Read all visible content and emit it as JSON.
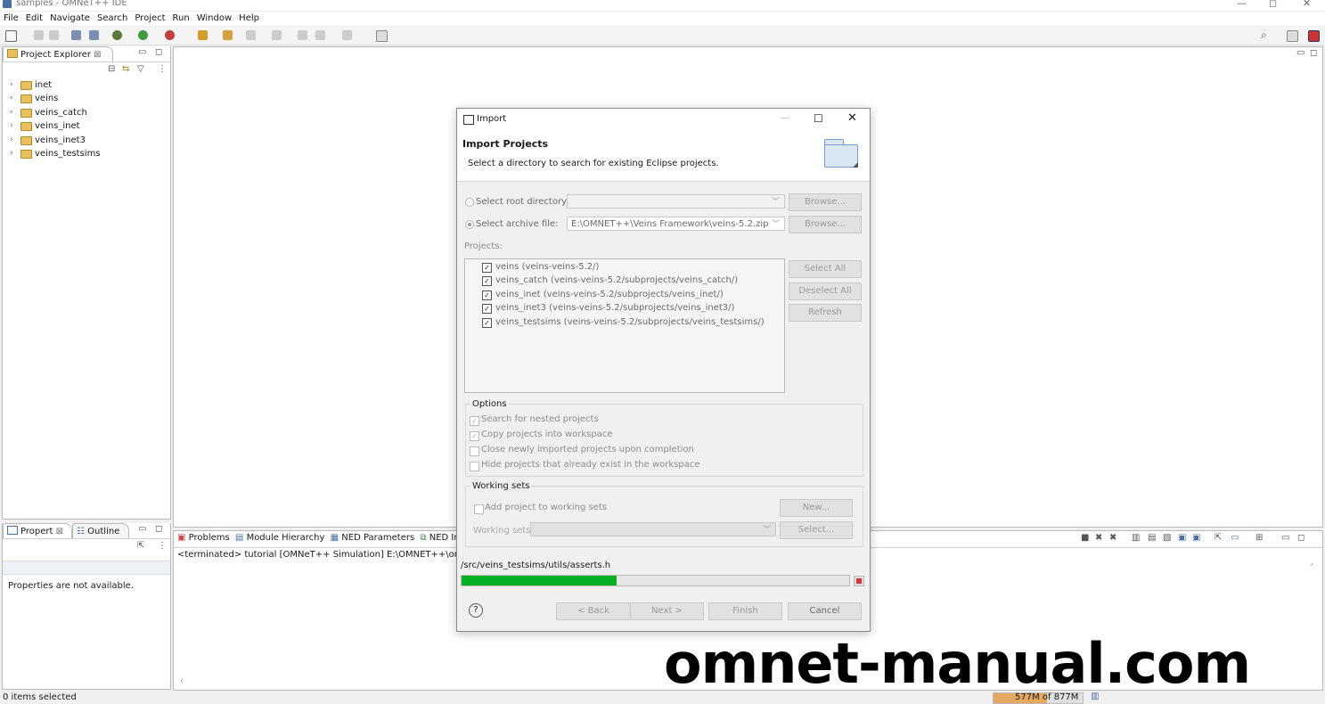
{
  "window": {
    "title": "samples - OMNeT++ IDE"
  },
  "menu": [
    "File",
    "Edit",
    "Navigate",
    "Search",
    "Project",
    "Run",
    "Window",
    "Help"
  ],
  "project_explorer": {
    "tab": "Project Explorer",
    "items": [
      "inet",
      "veins",
      "veins_catch",
      "veins_inet",
      "veins_inet3",
      "veins_testsims"
    ]
  },
  "properties": {
    "tabs": [
      "Propert",
      "Outline"
    ],
    "message": "Properties are not available."
  },
  "console": {
    "tabs": [
      "Problems",
      "Module Hierarchy",
      "NED Parameters",
      "NED Inh"
    ],
    "line": "<terminated> tutorial [OMNeT++ Simulation] E:\\OMNET++\\omnetpp"
  },
  "status": {
    "left": "0 items selected",
    "memory": "577M of 877M"
  },
  "dialog": {
    "title": "Import",
    "heading": "Import Projects",
    "description": "Select a directory to search for existing Eclipse projects.",
    "root_label": "Select root directory:",
    "archive_label": "Select archive file:",
    "archive_value": "E:\\OMNET++\\Veins Framework\\veins-5.2.zip",
    "browse": "Browse...",
    "projects_label": "Projects:",
    "projects": [
      "veins (veins-veins-5.2/)",
      "veins_catch (veins-veins-5.2/subprojects/veins_catch/)",
      "veins_inet (veins-veins-5.2/subprojects/veins_inet/)",
      "veins_inet3 (veins-veins-5.2/subprojects/veins_inet3/)",
      "veins_testsims (veins-veins-5.2/subprojects/veins_testsims/)"
    ],
    "select_all": "Select All",
    "deselect_all": "Deselect All",
    "refresh": "Refresh",
    "options_label": "Options",
    "options": [
      {
        "label": "Search for nested projects",
        "checked": true
      },
      {
        "label": "Copy projects into workspace",
        "checked": true
      },
      {
        "label": "Close newly imported projects upon completion",
        "checked": false
      },
      {
        "label": "Hide projects that already exist in the workspace",
        "checked": false
      }
    ],
    "working_sets_label": "Working sets",
    "add_to_ws": "Add project to working sets",
    "new": "New...",
    "ws_label": "Working sets:",
    "select": "Select...",
    "progress_text": "/src/veins_testsims/utils/asserts.h",
    "progress": 0.4,
    "back": "< Back",
    "next": "Next >",
    "finish": "Finish",
    "cancel": "Cancel"
  },
  "watermark": "omnet-manual.com",
  "colors": {
    "progress": "#06b025",
    "accent": "#4a6fa5"
  }
}
